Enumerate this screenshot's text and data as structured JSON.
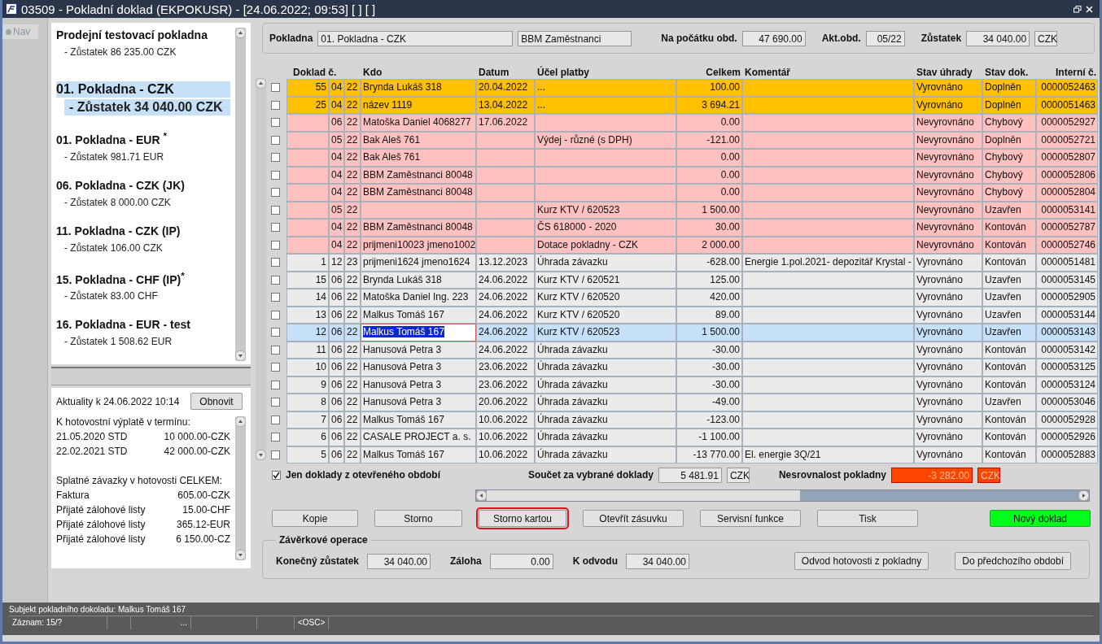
{
  "window": {
    "title": "03509 - Pokladní doklad (EKPOKUSR) - [24.06.2022; 09:53]  [ ]  [ ]"
  },
  "nav": {
    "label": "Nav"
  },
  "registers": [
    {
      "title": "Prodejní testovací pokladna",
      "balance": "- Zůstatek 86 235.00 CZK",
      "selected": false
    },
    {
      "title": "01. Pokladna - CZK",
      "balance": "- Zůstatek 34 040.00 CZK",
      "selected": true
    },
    {
      "title": "01. Pokladna - EUR $^{*}$",
      "balance": "- Zůstatek 981.71 EUR",
      "selected": false
    },
    {
      "title": "06. Pokladna  - CZK (JK)",
      "balance": "- Zůstatek 8 000.00 CZK",
      "selected": false
    },
    {
      "title": "11. Pokladna - CZK (IP)",
      "balance": "- Zůstatek 106.00 CZK",
      "selected": false
    },
    {
      "title": "15. Pokladna - CHF (IP)$^{*}$",
      "balance": "- Zůstatek 83.00 CHF",
      "selected": false
    },
    {
      "title": "16. Pokladna - EUR - test",
      "balance": "- Zůstatek 1 508.62 EUR",
      "selected": false
    }
  ],
  "news": {
    "heading": "Aktuality k 24.06.2022 10:14",
    "refresh_button": "Obnovit",
    "lines": [
      {
        "kind": "heading",
        "text": "K hotovostní výplatě v termínu:"
      },
      {
        "kind": "pair",
        "label": "21.05.2020 STD",
        "value": "10 000.00-CZK"
      },
      {
        "kind": "pair",
        "label": "22.02.2021 STD",
        "value": "42 000.00-CZK"
      },
      {
        "kind": "gap"
      },
      {
        "kind": "heading",
        "text": "Splatné závazky v hotovosti CELKEM:"
      },
      {
        "kind": "pair",
        "label": "Faktura",
        "value": "605.00-CZK"
      },
      {
        "kind": "pair",
        "label": "Přijaté zálohové listy",
        "value": "15.00-CHF"
      },
      {
        "kind": "pair",
        "label": "Přijaté zálohové listy",
        "value": "365.12-EUR"
      },
      {
        "kind": "pair",
        "label": "Přijaté zálohové listy",
        "value": "6 150.00-CZ"
      }
    ]
  },
  "header": {
    "register_label": "Pokladna",
    "register": "01. Pokladna - CZK",
    "subject": "BBM Zaměstnanci",
    "start_label": "Na počátku obd.",
    "start": "47 690.00",
    "period_label": "Akt.obd.",
    "period": "05/22",
    "balance_label": "Zůstatek",
    "balance": "34 040.00",
    "currency": "CZK"
  },
  "table": {
    "columns": [
      "Doklad č.",
      "Kdo",
      "Datum",
      "Účel platby",
      "Celkem",
      "Komentář",
      "Stav úhrady",
      "Stav dok.",
      "Interní č."
    ],
    "rows": [
      {
        "number": "55",
        "month": "04",
        "year": "22",
        "who": "Brynda Lukáš 318",
        "date": "20.04.2022",
        "purpose": "...",
        "total": "100.00",
        "payment": "Vyrovnáno",
        "state": "Doplněn",
        "internal": "0000052463",
        "color": "#ffc000",
        "selected": false,
        "checked": false
      },
      {
        "number": "25",
        "month": "04",
        "year": "22",
        "who": "název 1119",
        "date": "13.04.2022",
        "purpose": "...",
        "total": "3 694.21",
        "payment": "Vyrovnáno",
        "state": "Doplněn",
        "internal": "0000051463",
        "color": "#ffc000",
        "selected": false,
        "checked": false
      },
      {
        "month": "06",
        "year": "22",
        "who": "Matoška Daniel 4068277",
        "date": "17.06.2022",
        "total": "0.00",
        "payment": "Nevyrovnáno",
        "state": "Chybový",
        "internal": "0000052927",
        "color": "#ffc0c0",
        "selected": false,
        "checked": false
      },
      {
        "month": "05",
        "year": "22",
        "who": "Bak Aleš 761",
        "purpose": "Výdej - různé (s DPH)",
        "total": "-121.00",
        "payment": "Nevyrovnáno",
        "state": "Doplněn",
        "internal": "0000052721",
        "color": "#ffc0c0",
        "selected": false,
        "checked": false
      },
      {
        "month": "04",
        "year": "22",
        "who": "Bak Aleš 761",
        "total": "0.00",
        "payment": "Nevyrovnáno",
        "state": "Chybový",
        "internal": "0000052807",
        "color": "#ffc0c0",
        "selected": false,
        "checked": false
      },
      {
        "month": "04",
        "year": "22",
        "who": "BBM Zaměstnanci 80048",
        "total": "0.00",
        "payment": "Nevyrovnáno",
        "state": "Chybový",
        "internal": "0000052806",
        "color": "#ffc0c0",
        "selected": false,
        "checked": false
      },
      {
        "month": "04",
        "year": "22",
        "who": "BBM Zaměstnanci 80048",
        "total": "0.00",
        "payment": "Nevyrovnáno",
        "state": "Chybový",
        "internal": "0000052804",
        "color": "#ffc0c0",
        "selected": false,
        "checked": false
      },
      {
        "month": "05",
        "year": "22",
        "purpose": "Kurz KTV / 620523",
        "total": "1 500.00",
        "payment": "Nevyrovnáno",
        "state": "Uzavřen",
        "internal": "0000053141",
        "color": "#ffc0c0",
        "selected": false,
        "checked": false
      },
      {
        "month": "04",
        "year": "22",
        "who": "BBM Zaměstnanci 80048",
        "purpose": "ČS 618000 - 2020",
        "total": "30.00",
        "payment": "Nevyrovnáno",
        "state": "Kontován",
        "internal": "0000052787",
        "color": "#ffc0c0",
        "selected": false,
        "checked": false
      },
      {
        "month": "04",
        "year": "22",
        "who": "prijmeni10023 jmeno1002",
        "purpose": "Dotace pokladny - CZK",
        "total": "2 000.00",
        "payment": "Nevyrovnáno",
        "state": "Kontován",
        "internal": "0000052746",
        "color": "#ffc0c0",
        "selected": false,
        "checked": false
      },
      {
        "number": "1",
        "month": "12",
        "year": "23",
        "who": "prijmeni1624 jmeno1624",
        "date": "13.12.2023",
        "purpose": "Úhrada závazku",
        "total": "-628.00",
        "comment": "Energie 1.pol.2021- depozitář Krystal -",
        "payment": "Vyrovnáno",
        "state": "Kontován",
        "internal": "0000051481",
        "color": "#ebebeb",
        "selected": false,
        "checked": false
      },
      {
        "number": "15",
        "month": "06",
        "year": "22",
        "who": "Brynda Lukáš 318",
        "date": "24.06.2022",
        "purpose": "Kurz KTV / 620521",
        "total": "125.00",
        "payment": "Vyrovnáno",
        "state": "Uzavřen",
        "internal": "0000053145",
        "color": "#ebebeb",
        "selected": false,
        "checked": false
      },
      {
        "number": "14",
        "month": "06",
        "year": "22",
        "who": "Matoška Daniel Ing. 223",
        "date": "24.06.2022",
        "purpose": "Kurz KTV / 620520",
        "total": "420.00",
        "payment": "Vyrovnáno",
        "state": "Uzavřen",
        "internal": "0000052905",
        "color": "#ebebeb",
        "selected": false,
        "checked": false
      },
      {
        "number": "13",
        "month": "06",
        "year": "22",
        "who": "Malkus Tomáš 167",
        "date": "24.06.2022",
        "purpose": "Kurz KTV / 620520",
        "total": "89.00",
        "payment": "Vyrovnáno",
        "state": "Uzavřen",
        "internal": "0000053144",
        "color": "#ebebeb",
        "selected": false,
        "checked": false
      },
      {
        "number": "12",
        "month": "06",
        "year": "22",
        "who": "Malkus Tomáš 167",
        "date": "24.06.2022",
        "purpose": "Kurz KTV / 620523",
        "total": "1 500.00",
        "payment": "Vyrovnáno",
        "state": "Uzavřen",
        "internal": "0000053143",
        "selected": true,
        "checked": false
      },
      {
        "number": "11",
        "month": "06",
        "year": "22",
        "who": "Hanusová Petra 3",
        "date": "24.06.2022",
        "purpose": "Úhrada závazku",
        "total": "-30.00",
        "payment": "Vyrovnáno",
        "state": "Kontován",
        "internal": "0000053142",
        "color": "#ebebeb",
        "selected": false,
        "checked": false
      },
      {
        "number": "10",
        "month": "06",
        "year": "22",
        "who": "Hanusová Petra 3",
        "date": "23.06.2022",
        "purpose": "Úhrada závazku",
        "total": "-30.00",
        "payment": "Vyrovnáno",
        "state": "Kontován",
        "internal": "0000053125",
        "color": "#ebebeb",
        "selected": false,
        "checked": false
      },
      {
        "number": "9",
        "month": "06",
        "year": "22",
        "who": "Hanusová Petra 3",
        "date": "23.06.2022",
        "purpose": "Úhrada závazku",
        "total": "-30.00",
        "payment": "Vyrovnáno",
        "state": "Kontován",
        "internal": "0000053124",
        "color": "#ebebeb",
        "selected": false,
        "checked": false
      },
      {
        "number": "8",
        "month": "06",
        "year": "22",
        "who": "Hanusová Petra 3",
        "date": "20.06.2022",
        "purpose": "Úhrada závazku",
        "total": "-49.00",
        "payment": "Vyrovnáno",
        "state": "Uzavřen",
        "internal": "0000053046",
        "color": "#ebebeb",
        "selected": false,
        "checked": false
      },
      {
        "number": "7",
        "month": "06",
        "year": "22",
        "who": "Malkus Tomáš 167",
        "date": "10.06.2022",
        "purpose": "Úhrada závazku",
        "total": "-123.00",
        "payment": "Vyrovnáno",
        "state": "Kontován",
        "internal": "0000052928",
        "color": "#ebebeb",
        "selected": false,
        "checked": false
      },
      {
        "number": "6",
        "month": "06",
        "year": "22",
        "who": "CASALE PROJECT a. s.",
        "date": "10.06.2022",
        "purpose": "Úhrada závazku",
        "total": "-1 100.00",
        "payment": "Vyrovnáno",
        "state": "Kontován",
        "internal": "0000052926",
        "color": "#ebebeb",
        "selected": false,
        "checked": false
      },
      {
        "number": "5",
        "month": "06",
        "year": "22",
        "who": "Malkus Tomáš 167",
        "date": "10.06.2022",
        "purpose": "Úhrada závazku",
        "total": "-13 770.00",
        "comment": "El. energie 3Q/21",
        "payment": "Vyrovnáno",
        "state": "Kontován",
        "internal": "0000052883",
        "color": "#ebebeb",
        "selected": false,
        "checked": false
      }
    ]
  },
  "filter": {
    "label": "Jen doklady z otevřeného období",
    "checked": true
  },
  "sum": {
    "label": "Součet za vybrané doklady",
    "value": "5 481.91",
    "currency": "CZK"
  },
  "discrepancy": {
    "label": "Nesrovnalost pokladny",
    "value": "-3 282.00",
    "currency": "CZK"
  },
  "buttons": [
    {
      "label": "Kopie",
      "focused": false,
      "kind": "plain"
    },
    {
      "label": "Storno",
      "focused": false,
      "kind": "plain"
    },
    {
      "label": "Storno kartou",
      "focused": true,
      "kind": "plain"
    },
    {
      "label": "Otevřít zásuvku",
      "focused": false,
      "kind": "plain"
    },
    {
      "label": "Servisní funkce",
      "focused": false,
      "kind": "plain"
    },
    {
      "label": "Tisk",
      "focused": false,
      "kind": "plain"
    },
    {
      "label": "Nový doklad",
      "focused": false,
      "kind": "primary"
    }
  ],
  "closing": {
    "title": "Závěrkové operace",
    "final_label": "Konečný zůstatek",
    "final": "34 040.00",
    "advance_label": "Záloha",
    "advance": "0.00",
    "transfer_label": "K odvodu",
    "transfer": "34 040.00",
    "buttons": [
      "Odvod hotovosti z pokladny",
      "Do předchozího období"
    ]
  },
  "status_bar": {
    "message": "Subjekt pokladního dokoladu: Malkus Tomáš 167",
    "record": "Záznam: 15/?",
    "field_3": "...",
    "mode": "<OSC>"
  }
}
